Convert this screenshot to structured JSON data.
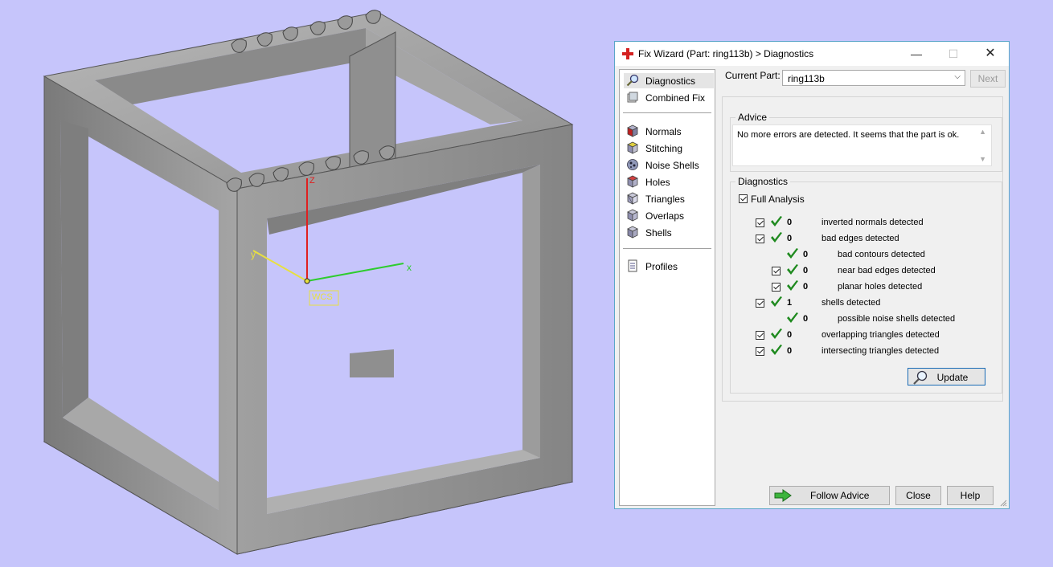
{
  "viewport": {
    "axis_labels": {
      "z": "Z",
      "x": "x",
      "y": "y"
    },
    "wcs_label": "WCS",
    "colors": {
      "background": "#c6c5fb",
      "model": "#9a9a9a",
      "axis_x": "#2ecc2e",
      "axis_y": "#e8e040",
      "axis_z": "#e02020"
    }
  },
  "window": {
    "title": "Fix Wizard (Part: ring113b) > Diagnostics",
    "minimize_glyph": "—",
    "maximize_glyph": "☐",
    "close_glyph": "✕"
  },
  "nav": {
    "items_top": [
      {
        "label": "Diagnostics",
        "icon": "magnifier-icon",
        "selected": true
      },
      {
        "label": "Combined Fix",
        "icon": "stack-icon"
      }
    ],
    "items_mid": [
      {
        "label": "Normals",
        "icon": "cube-red-icon"
      },
      {
        "label": "Stitching",
        "icon": "stitch-icon"
      },
      {
        "label": "Noise Shells",
        "icon": "noise-icon"
      },
      {
        "label": "Holes",
        "icon": "cube-hole-icon"
      },
      {
        "label": "Triangles",
        "icon": "triangle-icon"
      },
      {
        "label": "Overlaps",
        "icon": "overlap-icon"
      },
      {
        "label": "Shells",
        "icon": "shells-icon"
      }
    ],
    "items_bottom": [
      {
        "label": "Profiles",
        "icon": "document-icon"
      }
    ]
  },
  "current_part": {
    "label": "Current Part:",
    "value": "ring113b",
    "next_label": "Next"
  },
  "advice": {
    "title": "Advice",
    "text": "No more errors are detected. It seems that the part is ok."
  },
  "diagnostics": {
    "title": "Diagnostics",
    "full_analysis_label": "Full Analysis",
    "rows": [
      {
        "checkbox": true,
        "count": "0",
        "label": "inverted normals detected",
        "indent": 0
      },
      {
        "checkbox": true,
        "count": "0",
        "label": "bad edges detected",
        "indent": 0
      },
      {
        "checkbox": false,
        "count": "0",
        "label": "bad contours detected",
        "indent": 1
      },
      {
        "checkbox": true,
        "count": "0",
        "label": "near bad edges detected",
        "indent": 1
      },
      {
        "checkbox": true,
        "count": "0",
        "label": "planar holes detected",
        "indent": 1
      },
      {
        "checkbox": true,
        "count": "1",
        "label": "shells detected",
        "indent": 0
      },
      {
        "checkbox": false,
        "count": "0",
        "label": "possible noise shells detected",
        "indent": 1
      },
      {
        "checkbox": true,
        "count": "0",
        "label": "overlapping triangles detected",
        "indent": 0
      },
      {
        "checkbox": true,
        "count": "0",
        "label": "intersecting triangles detected",
        "indent": 0
      }
    ],
    "update_label": "Update"
  },
  "footer": {
    "follow_advice_label": "Follow Advice",
    "close_label": "Close",
    "help_label": "Help"
  }
}
